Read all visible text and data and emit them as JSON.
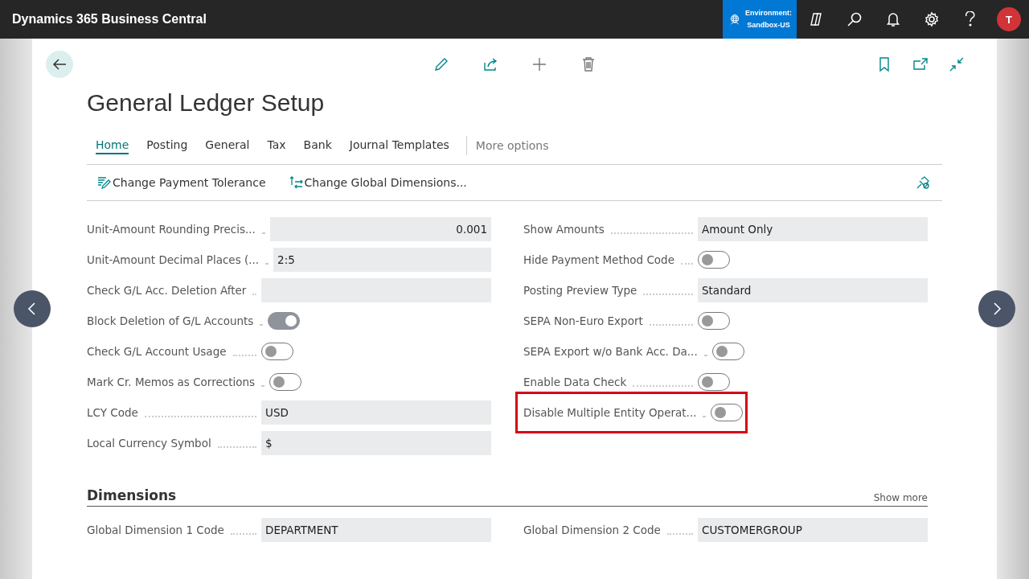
{
  "app_bar": {
    "title": "Dynamics 365 Business Central",
    "environment": {
      "label": "Environment:",
      "name": "Sandbox-US"
    },
    "avatar": "T"
  },
  "page": {
    "title": "General Ledger Setup",
    "tabs": [
      {
        "label": "Home",
        "selected": true
      },
      {
        "label": "Posting",
        "selected": false
      },
      {
        "label": "General",
        "selected": false
      },
      {
        "label": "Tax",
        "selected": false
      },
      {
        "label": "Bank",
        "selected": false
      },
      {
        "label": "Journal Templates",
        "selected": false
      }
    ],
    "more_options": "More options",
    "actions": [
      {
        "label": "Change Payment Tolerance"
      },
      {
        "label": "Change Global Dimensions..."
      }
    ]
  },
  "fields_left": [
    {
      "kind": "text",
      "label": "Unit-Amount Rounding Precis...",
      "value": "0.001",
      "numeric": true
    },
    {
      "kind": "text",
      "label": "Unit-Amount Decimal Places (...",
      "value": "2:5",
      "numeric": false
    },
    {
      "kind": "text",
      "label": "Check G/L Acc. Deletion After"
    },
    {
      "kind": "toggle",
      "label": "Block Deletion of G/L Accounts",
      "on": true
    },
    {
      "kind": "toggle",
      "label": "Check G/L Account Usage",
      "on": false
    },
    {
      "kind": "toggle",
      "label": "Mark Cr. Memos as Corrections",
      "on": false
    },
    {
      "kind": "text",
      "label": "LCY Code",
      "value": "USD",
      "numeric": false
    },
    {
      "kind": "text",
      "label": "Local Currency Symbol",
      "value": "$",
      "numeric": false
    }
  ],
  "fields_right": [
    {
      "kind": "text",
      "label": "Show Amounts",
      "value": "Amount Only",
      "numeric": false
    },
    {
      "kind": "toggle",
      "label": "Hide Payment Method Code",
      "on": false
    },
    {
      "kind": "text",
      "label": "Posting Preview Type",
      "value": "Standard",
      "numeric": false
    },
    {
      "kind": "toggle",
      "label": "SEPA Non-Euro Export",
      "on": false
    },
    {
      "kind": "toggle",
      "label": "SEPA Export w/o Bank Acc. Da...",
      "on": false
    },
    {
      "kind": "toggle",
      "label": "Enable Data Check",
      "on": false
    },
    {
      "kind": "toggle",
      "label": "Disable Multiple Entity Operat...",
      "on": false,
      "highlighted": true
    }
  ],
  "dimensions": {
    "title": "Dimensions",
    "show_more": "Show more",
    "fields_left": [
      {
        "kind": "text",
        "label": "Global Dimension 1 Code",
        "value": "DEPARTMENT",
        "numeric": false
      }
    ],
    "fields_right": [
      {
        "kind": "text",
        "label": "Global Dimension 2 Code",
        "value": "CUSTOMERGROUP",
        "numeric": false
      }
    ]
  }
}
